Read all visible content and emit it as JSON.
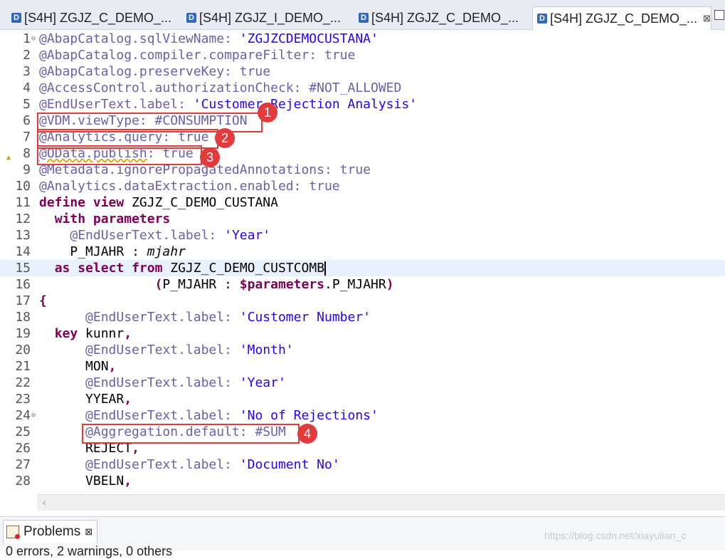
{
  "tabs": [
    {
      "label": "[S4H] ZGJZ_C_DEMO_...",
      "icon": "ddl-document-icon"
    },
    {
      "label": "[S4H] ZGJZ_I_DEMO_...",
      "icon": "ddl-document-icon"
    },
    {
      "label": "[S4H] ZGJZ_C_DEMO_...",
      "icon": "ddl-document-icon"
    },
    {
      "label": "[S4H] ZGJZ_C_DEMO_...",
      "icon": "ddl-document-icon",
      "active": true,
      "close": "⊠"
    }
  ],
  "editor": {
    "lines": [
      {
        "n": "1",
        "t": "@AbapCatalog.sqlViewName: 'ZGJZCDEMOCUSTANA'"
      },
      {
        "n": "2",
        "t": "@AbapCatalog.compiler.compareFilter: true"
      },
      {
        "n": "3",
        "t": "@AbapCatalog.preserveKey: true"
      },
      {
        "n": "4",
        "t": "@AccessControl.authorizationCheck: #NOT_ALLOWED"
      },
      {
        "n": "5",
        "t": "@EndUserText.label: 'Customer Rejection Analysis'"
      },
      {
        "n": "6",
        "t": "@VDM.viewType: #CONSUMPTION"
      },
      {
        "n": "7",
        "t": "@Analytics.query: true"
      },
      {
        "n": "8",
        "t": "@OData.publish: true"
      },
      {
        "n": "9",
        "t": "@Metadata.ignorePropagatedAnnotations: true"
      },
      {
        "n": "10",
        "t": "@Analytics.dataExtraction.enabled: true"
      },
      {
        "n": "11",
        "t": "define view ZGJZ_C_DEMO_CUSTANA"
      },
      {
        "n": "12",
        "t": "  with parameters"
      },
      {
        "n": "13",
        "t": "    @EndUserText.label: 'Year'"
      },
      {
        "n": "14",
        "t": "    P_MJAHR : mjahr"
      },
      {
        "n": "15",
        "t": "  as select from ZGJZ_C_DEMO_CUSTCOMB"
      },
      {
        "n": "16",
        "t": "               (P_MJAHR : $parameters.P_MJAHR)"
      },
      {
        "n": "17",
        "t": "{"
      },
      {
        "n": "18",
        "t": "      @EndUserText.label: 'Customer Number'"
      },
      {
        "n": "19",
        "t": "  key kunnr,"
      },
      {
        "n": "20",
        "t": "      @EndUserText.label: 'Month'"
      },
      {
        "n": "21",
        "t": "      MON,"
      },
      {
        "n": "22",
        "t": "      @EndUserText.label: 'Year'"
      },
      {
        "n": "23",
        "t": "      YYEAR,"
      },
      {
        "n": "24",
        "t": "      @EndUserText.label: 'No of Rejections'"
      },
      {
        "n": "25",
        "t": "      @Aggregation.default: #SUM"
      },
      {
        "n": "26",
        "t": "      REJECT,"
      },
      {
        "n": "27",
        "t": "      @EndUserText.label: 'Document No'"
      },
      {
        "n": "28",
        "t": "      VBELN,"
      }
    ]
  },
  "callouts": [
    "1",
    "2",
    "3",
    "4"
  ],
  "panel": {
    "tab_label": "Problems",
    "close": "⊠",
    "summary": "0 errors, 2 warnings, 0 others"
  },
  "watermark": "https://blog.csdn.net/xiayutian_c",
  "colors": {
    "annotation": "#6b5fa8",
    "keyword": "#7f0055",
    "string": "#2a00ff",
    "callout": "#e23b3b"
  }
}
